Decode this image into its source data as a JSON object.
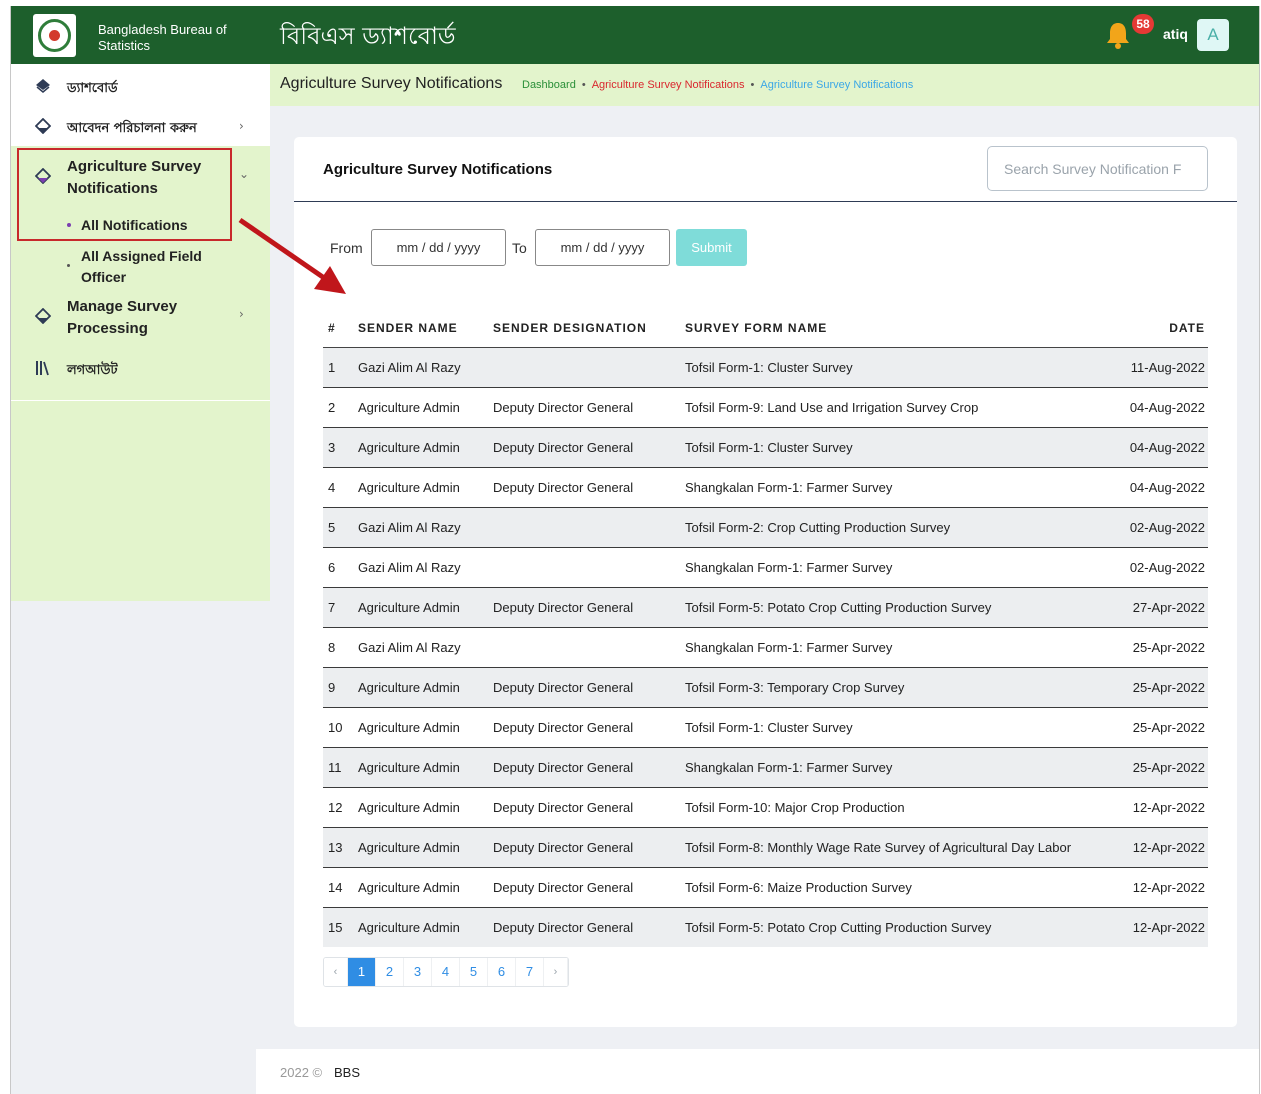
{
  "header": {
    "org_name": "Bangladesh Bureau of Statistics",
    "app_title": "বিবিএস ড্যাশবোর্ড",
    "notification_count": "58",
    "user_name": "atiq",
    "avatar_letter": "A"
  },
  "sidebar": {
    "items": [
      {
        "label": "ড্যাশবোর্ড"
      },
      {
        "label": "আবেদন পরিচালনা করুন"
      },
      {
        "label": "Agriculture Survey Notifications",
        "line1": "Agriculture Survey",
        "line2": "Notifications"
      },
      {
        "label": "Manage Survey Processing",
        "line1": "Manage Survey",
        "line2": "Processing"
      },
      {
        "label": "লগআউট"
      }
    ],
    "sub_items": [
      {
        "label": "All Notifications"
      },
      {
        "label": "All Assigned Field Officer",
        "line1": "All Assigned Field",
        "line2": "Officer"
      }
    ]
  },
  "breadcrumb": {
    "title": "Agriculture Survey Notifications",
    "items": [
      "Dashboard",
      "Agriculture Survey Notifications",
      "Agriculture Survey Notifications"
    ]
  },
  "card": {
    "title": "Agriculture Survey Notifications",
    "search_placeholder": "Search Survey Notification F"
  },
  "filter": {
    "from_label": "From",
    "to_label": "To",
    "from_value": "mm / dd / yyyy",
    "to_value": "mm / dd / yyyy",
    "submit_label": "Submit"
  },
  "table": {
    "columns": [
      "#",
      "SENDER NAME",
      "SENDER DESIGNATION",
      "SURVEY FORM NAME",
      "DATE"
    ],
    "rows": [
      [
        "1",
        "Gazi Alim Al Razy",
        "",
        "Tofsil Form-1: Cluster Survey",
        "11-Aug-2022"
      ],
      [
        "2",
        "Agriculture Admin",
        "Deputy Director General",
        "Tofsil Form-9: Land Use and Irrigation Survey Crop",
        "04-Aug-2022"
      ],
      [
        "3",
        "Agriculture Admin",
        "Deputy Director General",
        "Tofsil Form-1: Cluster Survey",
        "04-Aug-2022"
      ],
      [
        "4",
        "Agriculture Admin",
        "Deputy Director General",
        "Shangkalan Form-1: Farmer Survey",
        "04-Aug-2022"
      ],
      [
        "5",
        "Gazi Alim Al Razy",
        "",
        "Tofsil Form-2: Crop Cutting Production Survey",
        "02-Aug-2022"
      ],
      [
        "6",
        "Gazi Alim Al Razy",
        "",
        "Shangkalan Form-1: Farmer Survey",
        "02-Aug-2022"
      ],
      [
        "7",
        "Agriculture Admin",
        "Deputy Director General",
        "Tofsil Form-5: Potato Crop Cutting Production Survey",
        "27-Apr-2022"
      ],
      [
        "8",
        "Gazi Alim Al Razy",
        "",
        "Shangkalan Form-1: Farmer Survey",
        "25-Apr-2022"
      ],
      [
        "9",
        "Agriculture Admin",
        "Deputy Director General",
        "Tofsil Form-3: Temporary Crop Survey",
        "25-Apr-2022"
      ],
      [
        "10",
        "Agriculture Admin",
        "Deputy Director General",
        "Tofsil Form-1: Cluster Survey",
        "25-Apr-2022"
      ],
      [
        "11",
        "Agriculture Admin",
        "Deputy Director General",
        "Shangkalan Form-1: Farmer Survey",
        "25-Apr-2022"
      ],
      [
        "12",
        "Agriculture Admin",
        "Deputy Director General",
        "Tofsil Form-10: Major Crop Production",
        "12-Apr-2022"
      ],
      [
        "13",
        "Agriculture Admin",
        "Deputy Director General",
        "Tofsil Form-8: Monthly Wage Rate Survey of Agricultural Day Labor",
        "12-Apr-2022"
      ],
      [
        "14",
        "Agriculture Admin",
        "Deputy Director General",
        "Tofsil Form-6: Maize Production Survey",
        "12-Apr-2022"
      ],
      [
        "15",
        "Agriculture Admin",
        "Deputy Director General",
        "Tofsil Form-5: Potato Crop Cutting Production Survey",
        "12-Apr-2022"
      ]
    ]
  },
  "pagination": {
    "prev": "‹",
    "pages": [
      "1",
      "2",
      "3",
      "4",
      "5",
      "6",
      "7"
    ],
    "next": "›",
    "current": "1"
  },
  "footer": {
    "year": "2022 ©",
    "brand": "BBS"
  },
  "icons": {
    "logo": "bbs-logo-icon",
    "bell": "bell-icon",
    "dashboard": "diamond-icon",
    "menu": "ink-drop-icon",
    "logout": "books-icon"
  },
  "colors": {
    "header_bg": "#1d5f2c",
    "accent_light": "#e3f4cc",
    "highlight_border": "#c8292b",
    "pager_active": "#2f8de4",
    "submit_bg": "#7fdcd9"
  }
}
